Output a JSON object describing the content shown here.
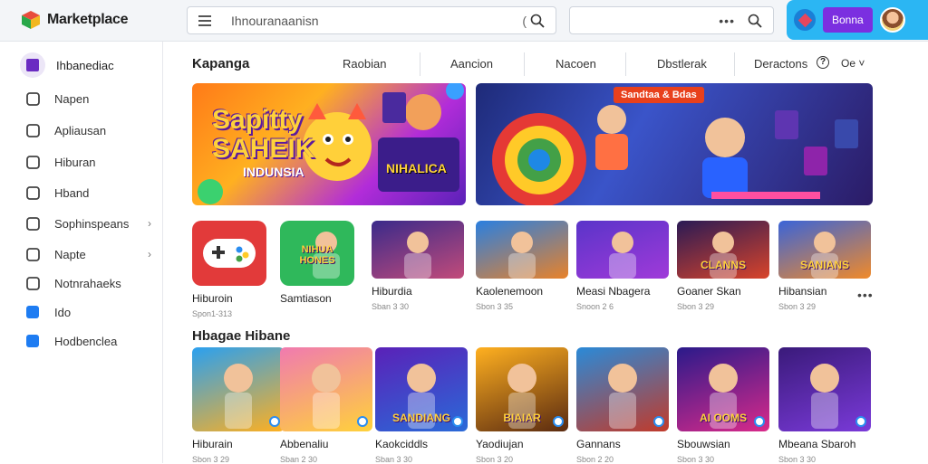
{
  "app": {
    "title": "Marketplace"
  },
  "search": {
    "placeholder": "Ihnouranaanisn",
    "spinner": "("
  },
  "search2": {
    "dots": "•••"
  },
  "user": {
    "button_label": "Bonna"
  },
  "sidebar": {
    "header": "Ihbanediac",
    "items": [
      {
        "label": "Napen",
        "icon": "rocket-icon",
        "chevron": ""
      },
      {
        "label": "Apliausan",
        "icon": "pin-icon",
        "chevron": ""
      },
      {
        "label": "Hiburan",
        "icon": "calendar-icon",
        "chevron": ""
      },
      {
        "label": "Hband",
        "icon": "people-icon",
        "chevron": ""
      },
      {
        "label": "Sophinspeans",
        "icon": "chat-icon",
        "chevron": "›"
      },
      {
        "label": "Napte",
        "icon": "target-icon",
        "chevron": "›"
      },
      {
        "label": "Notnrahaeks",
        "icon": "folder-icon",
        "chevron": ""
      },
      {
        "label": "Ido",
        "icon": "download-icon",
        "chevron": ""
      },
      {
        "label": "Hodbenclea",
        "icon": "info-icon",
        "chevron": ""
      }
    ]
  },
  "tabs": {
    "title": "Kapanga",
    "items": [
      "Raobian",
      "Aancion",
      "Nacoen",
      "Dbstlerak",
      "Deractons"
    ],
    "help": "?",
    "more": "Oe ˅"
  },
  "banners": [
    {
      "title_line1": "Sapitty",
      "title_line2": "SAHEIK",
      "title_line3": "INDUNSIA",
      "sign": "NIHALICA"
    },
    {
      "tag": "Sandtaa & Bdas"
    }
  ],
  "row1": [
    {
      "name": "Hiburoin",
      "meta": "Spon1-313",
      "label": ""
    },
    {
      "name": "Samtiason",
      "meta": "",
      "label": "NIHUA HONES"
    },
    {
      "name": "Hiburdia",
      "meta": "Sban 3 30",
      "label": ""
    },
    {
      "name": "Kaolenemoon",
      "meta": "Sbon 3 35",
      "label": ""
    },
    {
      "name": "Measi Nbagera",
      "meta": "Snoon 2 6",
      "label": ""
    },
    {
      "name": "Goaner Skan",
      "meta": "Sbon 3 29",
      "label": "CLANNS"
    },
    {
      "name": "Hibansian",
      "meta": "Sbon 3 29",
      "label": "SANIANS"
    }
  ],
  "row1_more": "•••",
  "section2": {
    "title": "Hbagae Hibane"
  },
  "row2": [
    {
      "name": "Hiburain",
      "meta": "Sbon 3 29",
      "label": ""
    },
    {
      "name": "Abbenaliu",
      "meta": "Sban 2 30",
      "label": ""
    },
    {
      "name": "Kaokciddls",
      "meta": "Sban 3 30",
      "label": "SANDIANG"
    },
    {
      "name": "Yaodiujan",
      "meta": "Sbon 3 20",
      "label": "BIAIAR"
    },
    {
      "name": "Gannans",
      "meta": "Sbon 2 20",
      "label": ""
    },
    {
      "name": "Sbouwsian",
      "meta": "Sbon 3 30",
      "label": "AI OOMS"
    },
    {
      "name": "Mbeana Sbaroh",
      "meta": "Sbon 3 30",
      "label": ""
    }
  ]
}
